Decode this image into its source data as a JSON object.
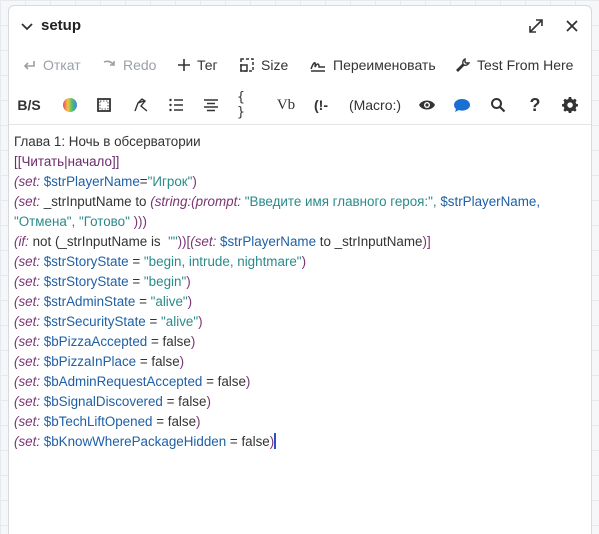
{
  "dialog": {
    "title": "setup",
    "icons": [
      "chevron-down-icon",
      "expand-icon",
      "close-icon"
    ]
  },
  "toolbar": {
    "undo_label": "Откат",
    "redo_label": "Redo",
    "tag_label": "Тег",
    "size_label": "Size",
    "rename_label": "Переименовать",
    "test_label": "Test From Here"
  },
  "toolbar2": {
    "strike_label": "B/S",
    "code_label": "{ }",
    "vb_label": "Vb",
    "comment_label": "(!-",
    "macro_label": "(Macro:)",
    "help_label": "?",
    "icons": [
      "palette-icon",
      "border-icon",
      "pen-icon",
      "list-icon",
      "align-icon",
      "eye-icon",
      "comment-icon",
      "search-icon",
      "gear-icon"
    ]
  },
  "colors": {
    "macro": "#7a3573",
    "variable": "#1e5fa6",
    "string": "#2a8a8a",
    "cursor": "#2a4fd0",
    "comment_icon": "#1a6fd4"
  },
  "editor": {
    "line1": "Глава 1: Ночь в обсерватории",
    "line2": "[[Читать|начало]]",
    "l3_kw": "(set:",
    "l3_var": "$strPlayerName",
    "l3_op": "=",
    "l3_str": "\"Игрок\"",
    "l3_end": ")",
    "l4_kw": "(set:",
    "l4_txt": "_strInputName to",
    "l4_kw2": "(string:",
    "l4_kw3": "(prompt:",
    "l4_str1": "\"Введите имя главного героя:\",",
    "l4_var": "$strPlayerName,",
    "l5_str": "\"Отмена\", \"Готово\"",
    "l5_end": ")))",
    "l6_kw": "(if:",
    "l6_txt": "not (_strInputName is",
    "l6_str": "\"\"",
    "l6_end": "))",
    "l6_hook": "[",
    "l6_kw2": "(set:",
    "l6_var": "$strPlayerName",
    "l6_txt2": "to _strInputName",
    "l6_end2": ")]",
    "l7_kw": "(set:",
    "l7_var": "$strStoryState",
    "l7_op": "=",
    "l7_str": "\"begin, intrude, nightmare\"",
    "l7_end": ")",
    "l8_kw": "(set:",
    "l8_var": "$strStoryState",
    "l8_op": "=",
    "l8_str": "\"begin\"",
    "l8_end": ")",
    "l9_kw": "(set:",
    "l9_var": "$strAdminState",
    "l9_op": "=",
    "l9_str": "\"alive\"",
    "l9_end": ")",
    "l10_kw": "(set:",
    "l10_var": "$strSecurityState",
    "l10_op": "=",
    "l10_str": "\"alive\"",
    "l10_end": ")",
    "l11_kw": "(set:",
    "l11_var": "$bPizzaAccepted",
    "l11_rest": "= false",
    "l11_end": ")",
    "l12_kw": "(set:",
    "l12_var": "$bPizzaInPlace",
    "l12_rest": "= false",
    "l12_end": ")",
    "l13_kw": "(set:",
    "l13_var": "$bAdminRequestAccepted",
    "l13_rest": "= false",
    "l13_end": ")",
    "l14_kw": "(set:",
    "l14_var": "$bSignalDiscovered",
    "l14_rest": "= false",
    "l14_end": ")",
    "l15_kw": "(set:",
    "l15_var": "$bTechLiftOpened",
    "l15_rest": "= false",
    "l15_end": ")",
    "l16_kw": "(set:",
    "l16_var": "$bKnowWherePackageHidden",
    "l16_rest": "= false",
    "l16_end": ")"
  }
}
